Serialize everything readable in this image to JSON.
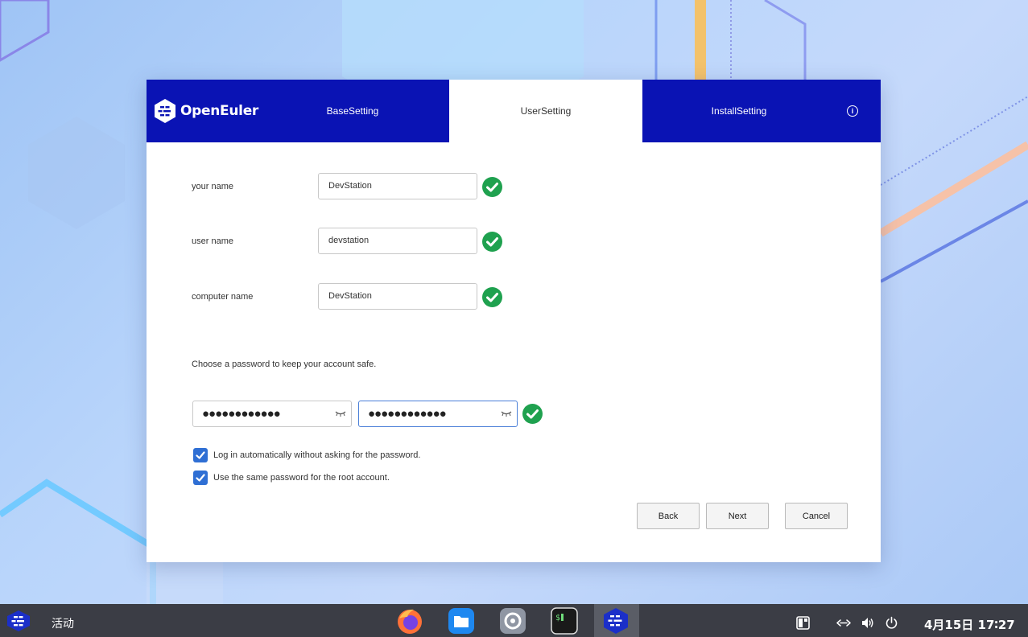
{
  "window": {
    "logo_text": "OpenEuler",
    "tabs": [
      {
        "label": "BaseSetting",
        "active": false
      },
      {
        "label": "UserSetting",
        "active": true
      },
      {
        "label": "InstallSetting",
        "active": false
      }
    ],
    "info_symbol": "i"
  },
  "form": {
    "your_name_label": "your name",
    "your_name_value": "DevStation",
    "user_name_label": "user name",
    "user_name_value": "devstation",
    "computer_name_label": "computer name",
    "computer_name_value": "DevStation",
    "password_hint": "Choose a password to keep your account safe.",
    "password_mask": "●●●●●●●●●●●●",
    "confirm_mask": "●●●●●●●●●●●●",
    "auto_login_label": "Log in automatically without asking for the password.",
    "auto_login_checked": true,
    "same_root_label": "Use the same password for the root account.",
    "same_root_checked": true
  },
  "buttons": {
    "back": "Back",
    "next": "Next",
    "cancel": "Cancel"
  },
  "taskbar": {
    "activities": "活动",
    "dock": [
      "firefox-icon",
      "files-icon",
      "settings-icon",
      "terminal-icon",
      "openeuler-installer-icon"
    ],
    "clock": "4月15日 17∶27"
  },
  "colors": {
    "header": "#0a13b4",
    "check_ok": "#1fa14f",
    "checkbox": "#2f6fd4"
  }
}
